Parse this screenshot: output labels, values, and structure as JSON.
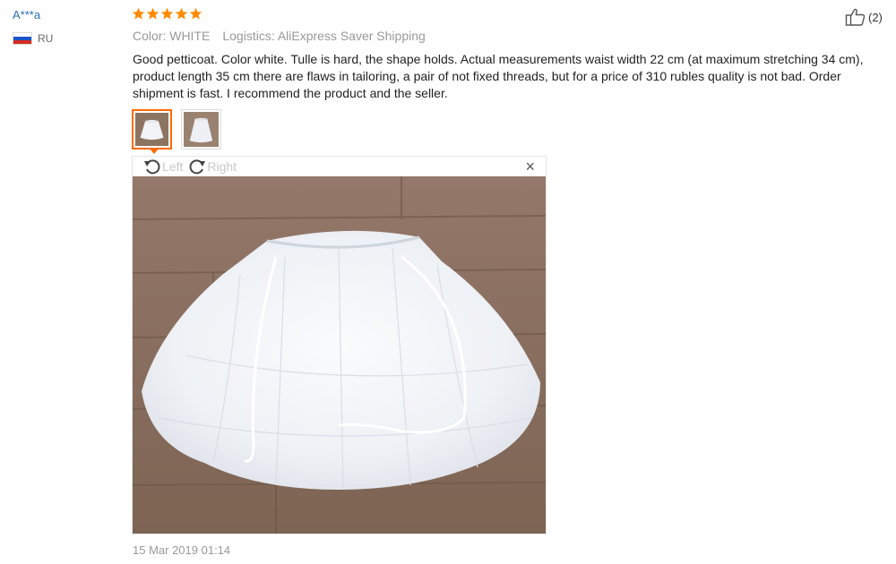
{
  "reviewer": {
    "name": "A***a",
    "country_code": "RU",
    "flag_colors": [
      "#ffffff",
      "#1c56c9",
      "#d52b1e"
    ]
  },
  "rating": {
    "stars": 5,
    "max": 5,
    "color": "#ff8a00"
  },
  "meta": {
    "color": "Color: WHITE",
    "logistics": "Logistics: AliExpress Saver Shipping"
  },
  "helpful": {
    "icon": "thumbs-up-icon",
    "count": "(2)"
  },
  "review": {
    "text": "Good petticoat. Color white. Tulle is hard, the shape holds. Actual measurements waist width 22 cm (at maximum stretching 34 cm), product length 35 cm there are flaws in tailoring, a pair of not fixed threads, but for a price of 310 rubles quality is not bad. Order shipment is fast. I recommend the product and the seller."
  },
  "thumbnails": [
    {
      "selected": true
    },
    {
      "selected": false
    }
  ],
  "viewer": {
    "rotate_left": "Left",
    "rotate_right": "Right",
    "close": "×"
  },
  "date": "15 Mar 2019 01:14",
  "colors": {
    "accent": "#ff6a00",
    "link": "#2a6fb5",
    "muted": "#999999",
    "wood": "#8a6f5a"
  }
}
